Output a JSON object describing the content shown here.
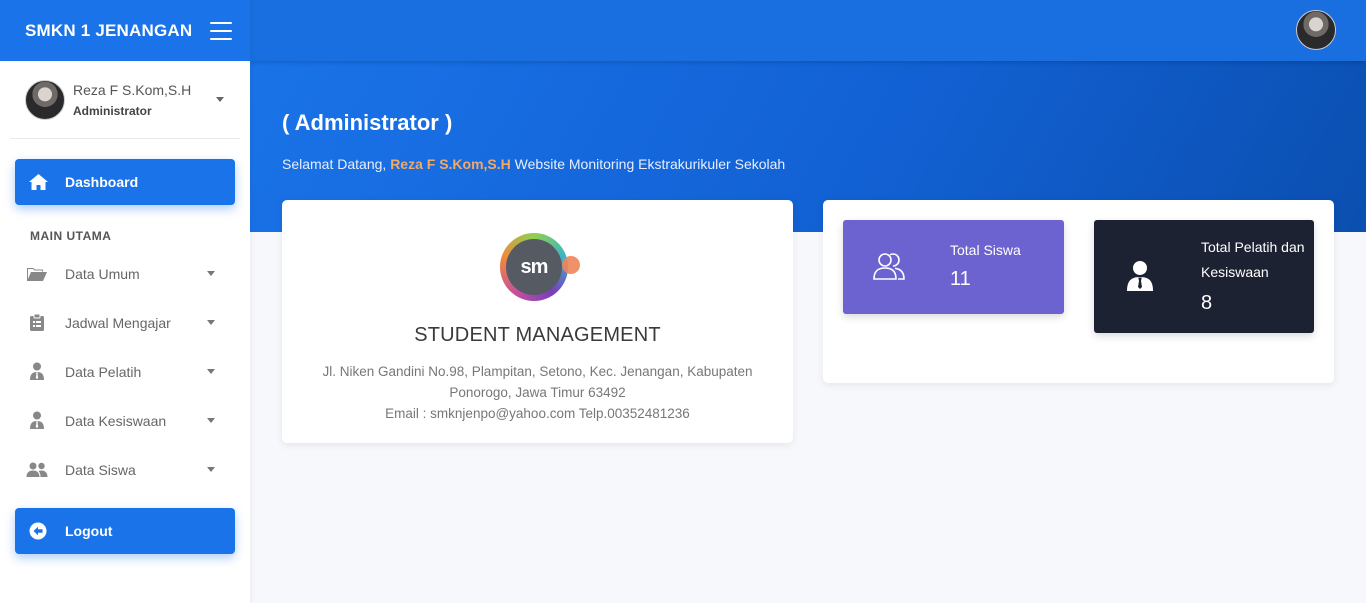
{
  "brand": {
    "title": "SMKN 1 JENANGAN"
  },
  "user": {
    "name": "Reza F S.Kom,S.H",
    "role": "Administrator"
  },
  "nav": {
    "dashboard_label": "Dashboard",
    "section_label": "MAIN UTAMA",
    "items": [
      {
        "label": "Data Umum",
        "icon": "folder-open-icon"
      },
      {
        "label": "Jadwal Mengajar",
        "icon": "clipboard-icon"
      },
      {
        "label": "Data Pelatih",
        "icon": "user-tie-icon"
      },
      {
        "label": "Data Kesiswaan",
        "icon": "user-tie-icon"
      },
      {
        "label": "Data Siswa",
        "icon": "users-icon"
      }
    ],
    "logout_label": "Logout"
  },
  "hero": {
    "title": "( Administrator )",
    "greeting_prefix": "Selamat Datang,",
    "greeting_name": "Reza F S.Kom,S.H",
    "greeting_suffix": "Website Monitoring Ekstrakurikuler Sekolah"
  },
  "school": {
    "logo_text": "sm",
    "title": "STUDENT MANAGEMENT",
    "address_line1": "Jl. Niken Gandini No.98, Plampitan, Setono, Kec. Jenangan, Kabupaten Ponorogo, Jawa Timur 63492",
    "address_line2": "Email : smknjenpo@yahoo.com Telp.00352481236"
  },
  "stats": {
    "siswa": {
      "label": "Total Siswa",
      "value": "11"
    },
    "pelatih": {
      "label": "Total Pelatih dan Kesiswaan",
      "value": "8"
    }
  },
  "colors": {
    "primary": "#1a73e8",
    "accent_name": "#f2a966",
    "stat_siswa": "#6c63d1",
    "stat_pelatih": "#1d2233"
  }
}
